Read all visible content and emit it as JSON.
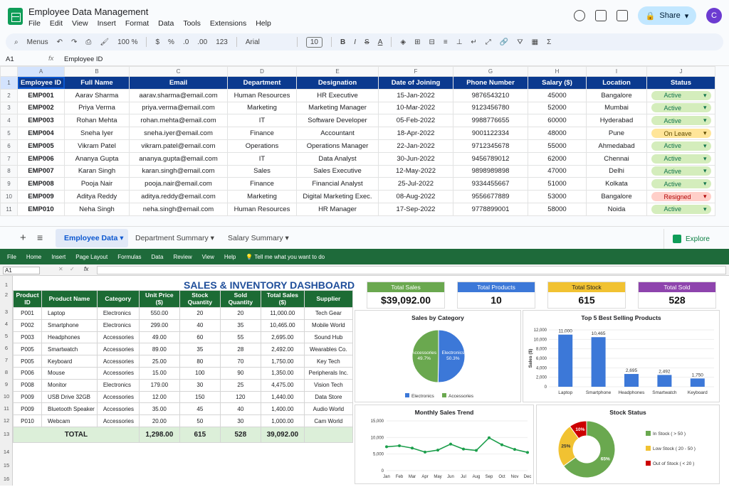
{
  "gsheet": {
    "title": "Employee Data Management",
    "menu": [
      "File",
      "Edit",
      "View",
      "Insert",
      "Format",
      "Data",
      "Tools",
      "Extensions",
      "Help"
    ],
    "share_label": "Share",
    "avatar_letter": "C",
    "toolbar": {
      "menus": "Menus",
      "zoom": "100 %",
      "currency": "$",
      "percent": "%",
      "dec_down": ".0",
      "dec_up": ".00",
      "format_123": "123",
      "font": "Arial",
      "font_size": "10",
      "bold": "B",
      "italic": "I",
      "strike": "S",
      "text_color": "A",
      "sum": "Σ"
    },
    "cell_ref": "A1",
    "fx": "fx",
    "formula_value": "Employee ID",
    "columns": [
      "A",
      "B",
      "C",
      "D",
      "E",
      "F",
      "G",
      "H",
      "I",
      "J"
    ],
    "headers": [
      "Employee ID",
      "Full Name",
      "Email",
      "Department",
      "Designation",
      "Date of Joining",
      "Phone Number",
      "Salary ($)",
      "Location",
      "Status"
    ],
    "rows": [
      [
        "EMP001",
        "Aarav Sharma",
        "aarav.sharma@email.com",
        "Human Resources",
        "HR Executive",
        "15-Jan-2022",
        "9876543210",
        "45000",
        "Bangalore",
        "Active"
      ],
      [
        "EMP002",
        "Priya Verma",
        "priya.verma@email.com",
        "Marketing",
        "Marketing Manager",
        "10-Mar-2022",
        "9123456780",
        "52000",
        "Mumbai",
        "Active"
      ],
      [
        "EMP003",
        "Rohan Mehta",
        "rohan.mehta@email.com",
        "IT",
        "Software Developer",
        "05-Feb-2022",
        "9988776655",
        "60000",
        "Hyderabad",
        "Active"
      ],
      [
        "EMP004",
        "Sneha Iyer",
        "sneha.iyer@email.com",
        "Finance",
        "Accountant",
        "18-Apr-2022",
        "9001122334",
        "48000",
        "Pune",
        "On Leave"
      ],
      [
        "EMP005",
        "Vikram Patel",
        "vikram.patel@email.com",
        "Operations",
        "Operations Manager",
        "22-Jan-2022",
        "9712345678",
        "55000",
        "Ahmedabad",
        "Active"
      ],
      [
        "EMP006",
        "Ananya Gupta",
        "ananya.gupta@email.com",
        "IT",
        "Data Analyst",
        "30-Jun-2022",
        "9456789012",
        "62000",
        "Chennai",
        "Active"
      ],
      [
        "EMP007",
        "Karan Singh",
        "karan.singh@email.com",
        "Sales",
        "Sales Executive",
        "12-May-2022",
        "9898989898",
        "47000",
        "Delhi",
        "Active"
      ],
      [
        "EMP008",
        "Pooja Nair",
        "pooja.nair@email.com",
        "Finance",
        "Financial Analyst",
        "25-Jul-2022",
        "9334455667",
        "51000",
        "Kolkata",
        "Active"
      ],
      [
        "EMP009",
        "Aditya Reddy",
        "aditya.reddy@email.com",
        "Marketing",
        "Digital Marketing Exec.",
        "08-Aug-2022",
        "9556677889",
        "53000",
        "Bangalore",
        "Resigned"
      ],
      [
        "EMP010",
        "Neha Singh",
        "neha.singh@email.com",
        "Human Resources",
        "HR Manager",
        "17-Sep-2022",
        "9778899001",
        "58000",
        "Noida",
        "Active"
      ]
    ],
    "tabs": [
      "Employee Data",
      "Department Summary",
      "Salary Summary"
    ],
    "explore": "Explore",
    "colors": {
      "header_bg": "#0b3a8f",
      "active": "#d4edbc",
      "on_leave": "#ffe599",
      "resigned": "#ffcfc9"
    }
  },
  "excel": {
    "ribbon": [
      "File",
      "Home",
      "Insert",
      "Page Layout",
      "Formulas",
      "Data",
      "Review",
      "View",
      "Help",
      "Tell me what you want to do"
    ],
    "cell_ref": "A1",
    "fx": "fx",
    "dashboard_title": "SALES & INVENTORY DASHBOARD",
    "headers": [
      "Product ID",
      "Product Name",
      "Category",
      "Unit Price ($)",
      "Stock Quantity",
      "Sold Quantity",
      "Total Sales ($)",
      "Supplier"
    ],
    "rows": [
      [
        "P001",
        "Laptop",
        "Electronics",
        "550.00",
        "20",
        "20",
        "11,000.00",
        "Tech Gear"
      ],
      [
        "P002",
        "Smartphone",
        "Electronics",
        "299.00",
        "40",
        "35",
        "10,465.00",
        "Mobile World"
      ],
      [
        "P003",
        "Headphones",
        "Accessories",
        "49.00",
        "60",
        "55",
        "2,695.00",
        "Sound Hub"
      ],
      [
        "P005",
        "Smartwatch",
        "Accessories",
        "89.00",
        "35",
        "28",
        "2,492.00",
        "Wearables Co."
      ],
      [
        "P005",
        "Keyboard",
        "Accessories",
        "25.00",
        "80",
        "70",
        "1,750.00",
        "Key Tech"
      ],
      [
        "P006",
        "Mouse",
        "Accessories",
        "15.00",
        "100",
        "90",
        "1,350.00",
        "Peripherals Inc."
      ],
      [
        "P008",
        "Monitor",
        "Electronics",
        "179.00",
        "30",
        "25",
        "4,475.00",
        "Vision Tech"
      ],
      [
        "P009",
        "USB Drive 32GB",
        "Accessories",
        "12.00",
        "150",
        "120",
        "1,440.00",
        "Data Store"
      ],
      [
        "P009",
        "Bluetooth Speaker",
        "Accessories",
        "35.00",
        "45",
        "40",
        "1,400.00",
        "Audio World"
      ],
      [
        "P010",
        "Webcam",
        "Accessories",
        "20.00",
        "50",
        "30",
        "1,000.00",
        "Cam World"
      ]
    ],
    "total": {
      "label": "TOTAL",
      "unit_price": "1,298.00",
      "stock": "615",
      "sold": "528",
      "sales": "39,092.00"
    },
    "kpis": [
      {
        "label": "Total Sales",
        "value": "$39,092.00",
        "color": "#6aa84f"
      },
      {
        "label": "Total Products",
        "value": "10",
        "color": "#3c78d8"
      },
      {
        "label": "Total Stock",
        "value": "615",
        "color": "#f1c232"
      },
      {
        "label": "Total Sold",
        "value": "528",
        "color": "#8e44ad"
      }
    ]
  },
  "chart_data": [
    {
      "type": "pie",
      "title": "Sales by Category",
      "categories": [
        "Electronics",
        "Accessories"
      ],
      "values": [
        50.3,
        49.7
      ],
      "slice_labels": [
        "Electronics\n50.3%",
        "Accessories\n49.7%"
      ],
      "colors": [
        "#3c78d8",
        "#6aa84f"
      ],
      "legend": "bottom"
    },
    {
      "type": "bar",
      "title": "Top 5 Best Selling Products",
      "categories": [
        "Laptop",
        "Smartphone",
        "Headphones",
        "Smartwatch",
        "Keyboard"
      ],
      "values": [
        11000,
        10465,
        2695,
        2492,
        1750
      ],
      "data_labels": [
        "11,000",
        "10,465",
        "2,695",
        "2,492",
        "1,750"
      ],
      "ylabel": "Sales ($)",
      "yticks": [
        "0",
        "2,000",
        "4,000",
        "6,000",
        "8,000",
        "10,000",
        "12,000"
      ],
      "ylim": [
        0,
        12000
      ],
      "color": "#3c78d8"
    },
    {
      "type": "line",
      "title": "Monthly Sales Trend",
      "categories": [
        "Jan",
        "Feb",
        "Mar",
        "Apr",
        "May",
        "Jun",
        "Jul",
        "Aug",
        "Sep",
        "Oct",
        "Nov",
        "Dec"
      ],
      "values": [
        7200,
        7500,
        6800,
        5600,
        6200,
        8000,
        6500,
        6100,
        9900,
        7800,
        6400,
        5500
      ],
      "yticks": [
        "0",
        "5,000",
        "10,000",
        "15,000"
      ],
      "ylim": [
        0,
        15000
      ],
      "color": "#1b9e4b"
    },
    {
      "type": "pie",
      "title": "Stock Status",
      "categories": [
        "In Stock ( > 50 )",
        "Low Stock ( 20 - 50 )",
        "Out of Stock ( < 20 )"
      ],
      "values": [
        65,
        25,
        10
      ],
      "slice_labels": [
        "65%",
        "25%",
        "10%"
      ],
      "colors": [
        "#6aa84f",
        "#f1c232",
        "#cc0000"
      ],
      "legend": "right"
    }
  ]
}
